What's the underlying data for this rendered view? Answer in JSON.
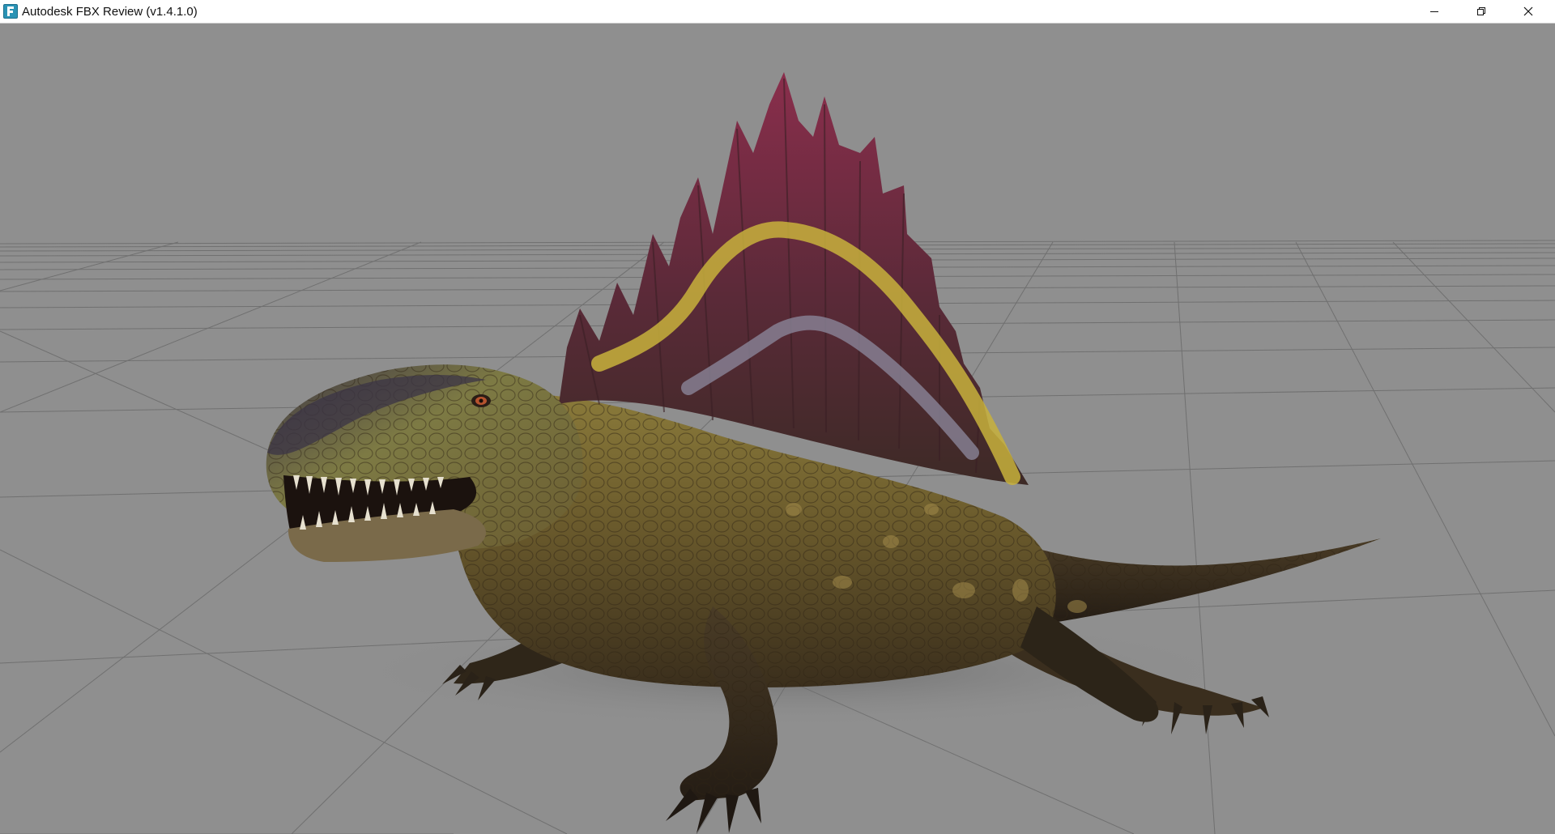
{
  "window": {
    "title": "Autodesk FBX Review (v1.4.1.0)",
    "app_icon": "fbx-review-app-icon",
    "controls": [
      {
        "name": "minimize-button",
        "icon": "minimize-icon"
      },
      {
        "name": "restore-button",
        "icon": "restore-icon"
      },
      {
        "name": "close-button",
        "icon": "close-icon"
      }
    ]
  },
  "viewport": {
    "background_color": "#8f8f8f",
    "grid_color": "#6e6e6e",
    "model": "dimetrodon-model"
  }
}
